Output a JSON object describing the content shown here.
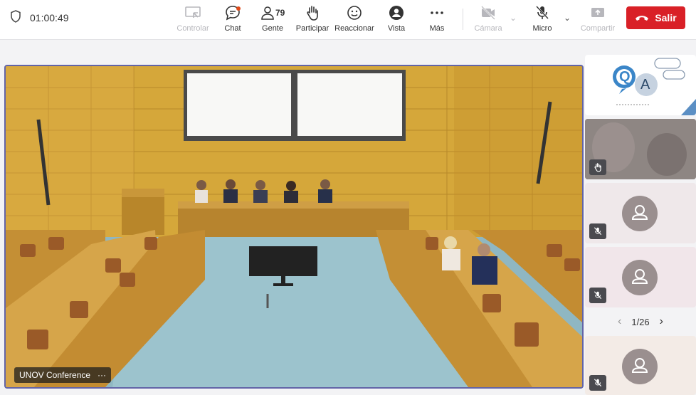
{
  "timer": "01:00:49",
  "toolbar": {
    "controlar": "Controlar",
    "chat": "Chat",
    "gente": "Gente",
    "gente_count": "79",
    "participar": "Participar",
    "reaccionar": "Reaccionar",
    "vista": "Vista",
    "mas": "Más",
    "camara": "Cámara",
    "micro": "Micro",
    "compartir": "Compartir",
    "salir": "Salir"
  },
  "stage": {
    "label": "UNOV Conference",
    "more": "···"
  },
  "sidebar": {
    "pager": "1/26",
    "qa_letters": [
      "Q",
      "A"
    ]
  },
  "colors": {
    "accent": "#6264a7",
    "leave": "#d92027"
  }
}
